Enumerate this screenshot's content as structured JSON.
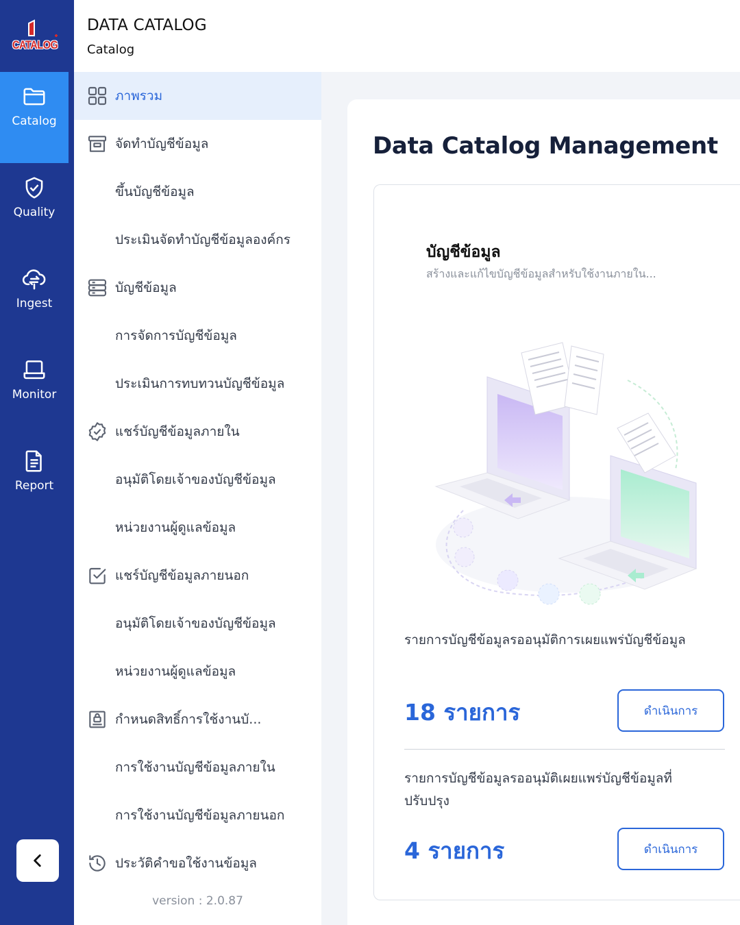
{
  "logo": {
    "text": "CATALOG"
  },
  "rail": {
    "items": [
      {
        "label": "Catalog",
        "icon": "folder-icon",
        "active": true
      },
      {
        "label": "Quality",
        "icon": "shield-check-icon",
        "active": false
      },
      {
        "label": "Ingest",
        "icon": "cloud-sync-icon",
        "active": false
      },
      {
        "label": "Monitor",
        "icon": "laptop-icon",
        "active": false
      },
      {
        "label": "Report",
        "icon": "document-icon",
        "active": false
      }
    ]
  },
  "header": {
    "title": "DATA CATALOG",
    "subtitle": "Catalog"
  },
  "submenu": {
    "items": [
      {
        "label": "ภาพรวม",
        "icon": "grid-icon",
        "active": true
      },
      {
        "label": "จัดทำบัญชีข้อมูล",
        "icon": "archive-box-icon"
      },
      {
        "label": "ขึ้นบัญชีข้อมูล"
      },
      {
        "label": "ประเมินจัดทำบัญชีข้อมูลองค์กร"
      },
      {
        "label": "บัญชีข้อมูล",
        "icon": "server-icon"
      },
      {
        "label": "การจัดการบัญชีข้อมูล"
      },
      {
        "label": "ประเมินการทบทวนบัญชีข้อมูล"
      },
      {
        "label": "แชร์บัญชีข้อมูลภายใน",
        "icon": "badge-check-icon"
      },
      {
        "label": "อนุมัติโดยเจ้าของบัญชีข้อมูล"
      },
      {
        "label": "หน่วยงานผู้ดูแลข้อมูล"
      },
      {
        "label": "แชร์บัญชีข้อมูลภายนอก",
        "icon": "checkbox-icon"
      },
      {
        "label": "อนุมัติโดยเจ้าของบัญชีข้อมูล"
      },
      {
        "label": "หน่วยงานผู้ดูแลข้อมูล"
      },
      {
        "label": "กำหนดสิทธิ์การใช้งานบั...",
        "icon": "user-lock-icon"
      },
      {
        "label": "การใช้งานบัญชีข้อมูลภายใน"
      },
      {
        "label": "การใช้งานบัญชีข้อมูลภายนอก"
      },
      {
        "label": "ประวัติคำขอใช้งานข้อมูล",
        "icon": "clock-history-icon"
      }
    ],
    "version": "version : 2.0.87"
  },
  "main": {
    "title": "Data Catalog Management",
    "section": {
      "title": "บัญชีข้อมูล",
      "description": "สร้างและแก้ไขบัญชีข้อมูลสำหรับใช้งานภายใน...",
      "pending": [
        {
          "text": "รายการบัญชีข้อมูลรออนุมัติการเผยแพร่บัญชีข้อมูล",
          "count": "18 รายการ",
          "action": "ดำเนินการ"
        },
        {
          "text": "รายการบัญชีข้อมูลรออนุมัติเผยแพร่บัญชีข้อมูลที่ปรับปรุง",
          "count": "4 รายการ",
          "action": "ดำเนินการ"
        }
      ]
    }
  },
  "colors": {
    "rail": "#1e3891",
    "active": "#2f8cf2",
    "accent": "#2a66d9"
  }
}
